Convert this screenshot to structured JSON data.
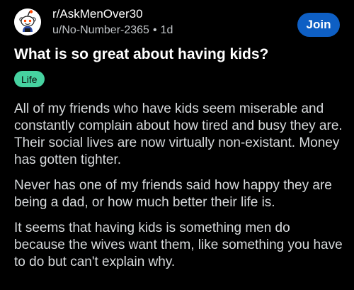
{
  "community": {
    "name": "r/AskMenOver30",
    "author": "u/No-Number-2365",
    "separator": "•",
    "age": "1d",
    "join_label": "Join",
    "avatar_icon": "reddit-snoo-icon"
  },
  "post": {
    "title": "What is so great about having kids?",
    "flair": "Life",
    "flair_color": "#46d2a0",
    "paragraphs": [
      "All of my friends who have kids seem miserable and constantly complain about how tired and busy they are. Their social lives are now virtually non-existant. Money has gotten tighter.",
      "Never has one of my friends said how happy they are being a dad, or how much better their life is.",
      "It seems that having kids is something men do because the wives want them, like something you have to do but can't explain why."
    ]
  },
  "colors": {
    "background": "#000000",
    "accent": "#0e5fc4",
    "text": "#d7dadc"
  }
}
